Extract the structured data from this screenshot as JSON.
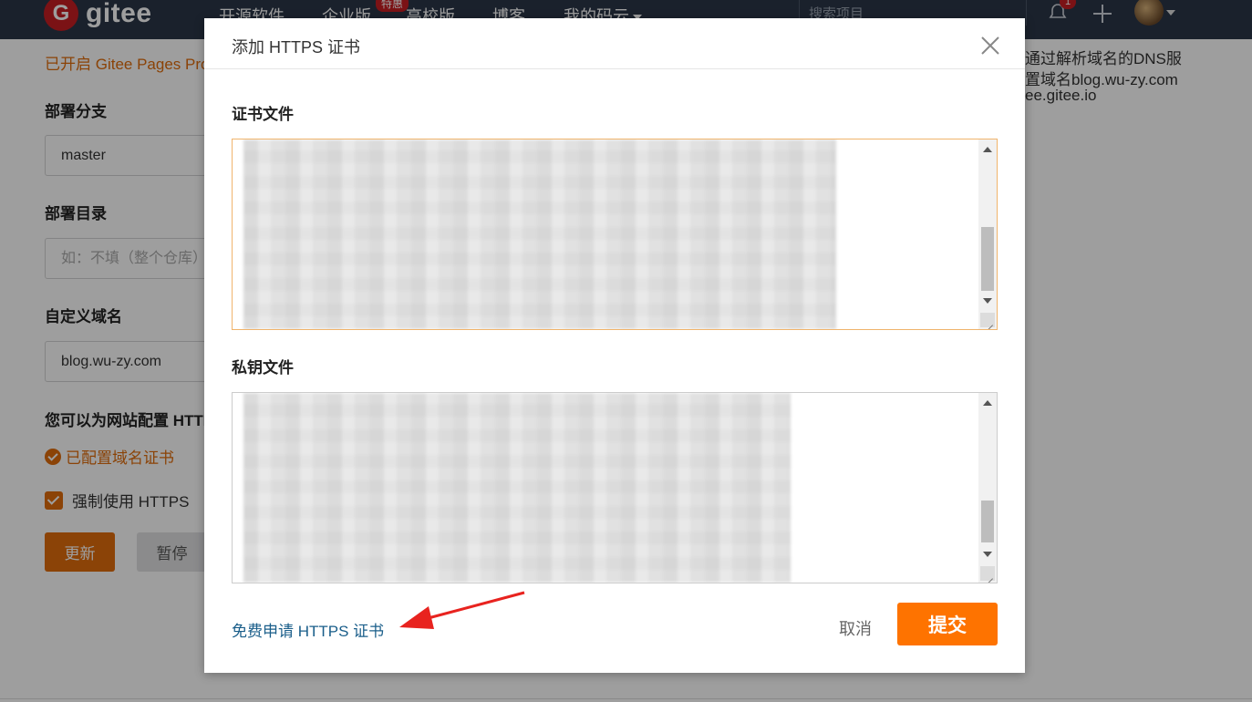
{
  "nav": {
    "logo_letter": "G",
    "logo_text": "gitee",
    "items": [
      "开源软件",
      "企业版",
      "高校版",
      "博客",
      "我的码云"
    ],
    "badge": "特惠",
    "search_placeholder": "搜索项目",
    "notification_count": "1"
  },
  "page": {
    "notice": "已开启 Gitee Pages Pro",
    "right_lines": [
      "通过解析域名的DNS服",
      "置域名blog.wu-zy.com",
      "ee.gitee.io"
    ],
    "branch_label": "部署分支",
    "branch_value": "master",
    "dir_label": "部署目录",
    "dir_placeholder": "如：不填（整个仓库）",
    "domain_label": "自定义域名",
    "domain_value": "blog.wu-zy.com",
    "https_label": "您可以为网站配置 HTTP",
    "cert_status": "已配置域名证书",
    "force_https": "强制使用 HTTPS",
    "update_btn": "更新",
    "pause_btn": "暂停"
  },
  "modal": {
    "title": "添加 HTTPS 证书",
    "cert_label": "证书文件",
    "key_label": "私钥文件",
    "free_link": "免费申请 HTTPS 证书",
    "cancel": "取消",
    "submit": "提交"
  },
  "colors": {
    "accent": "#e06d0c",
    "submit": "#fe7300",
    "nav_bg": "#2b3648",
    "annotation_arrow": "#e8231f"
  }
}
